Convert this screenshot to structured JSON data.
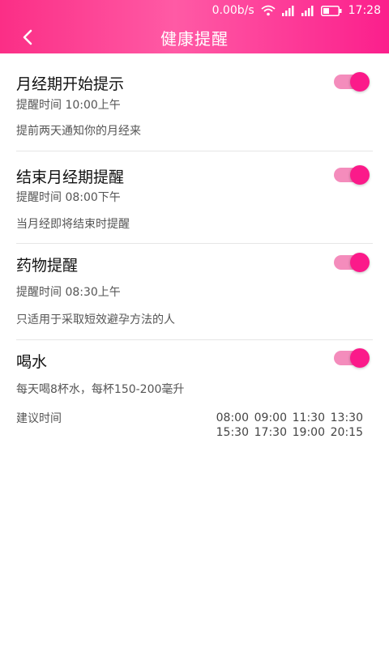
{
  "status_bar": {
    "network_speed": "0.00b/s",
    "time": "17:28",
    "icons": [
      "wifi-icon",
      "signal-icon",
      "signal-icon",
      "battery-icon"
    ]
  },
  "header": {
    "title": "健康提醒",
    "back_icon": "chevron-left-icon"
  },
  "reminders": [
    {
      "title": "月经期开始提示",
      "time_text": "提醒时间 10:00上午",
      "description": "提前两天通知你的月经来",
      "enabled": true
    },
    {
      "title": "结束月经期提醒",
      "time_text": "提醒时间 08:00下午",
      "description": "当月经即将结束时提醒",
      "enabled": true
    },
    {
      "title": "药物提醒",
      "time_text": "提醒时间 08:30上午",
      "description": "只适用于采取短效避孕方法的人",
      "enabled": true
    },
    {
      "title": "喝水",
      "description": "每天喝8杯水，每杯150-200毫升",
      "suggest_label": "建议时间",
      "times": [
        "08:00",
        "09:00",
        "11:30",
        "13:30",
        "15:30",
        "17:30",
        "19:00",
        "20:15"
      ],
      "enabled": true
    }
  ],
  "colors": {
    "accent": "#fb1a8a",
    "toggle_track": "#f48cbc",
    "header_gradient_start": "#fb2e86",
    "header_gradient_end": "#fb1f8c"
  }
}
